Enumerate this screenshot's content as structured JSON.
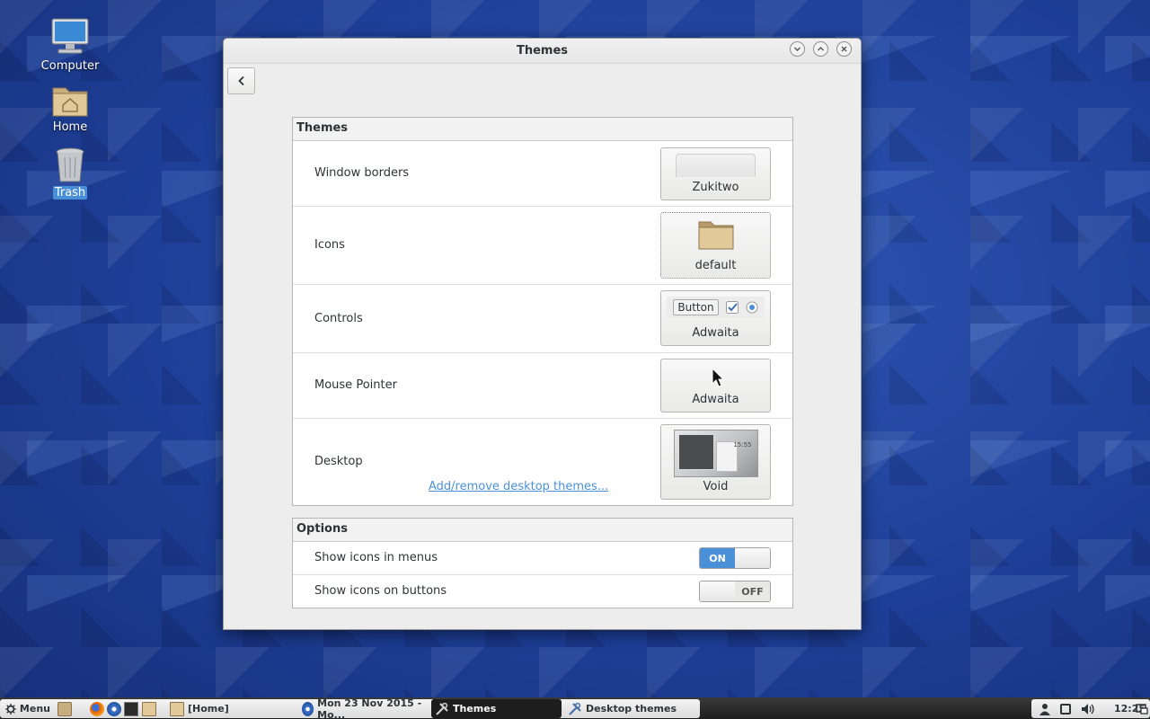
{
  "desktop": {
    "icons": [
      {
        "label": "Computer"
      },
      {
        "label": "Home"
      },
      {
        "label": "Trash"
      }
    ]
  },
  "window": {
    "title": "Themes",
    "themes_section": {
      "header": "Themes",
      "rows": [
        {
          "label": "Window borders",
          "value": "Zukitwo"
        },
        {
          "label": "Icons",
          "value": "default"
        },
        {
          "label": "Controls",
          "value": "Adwaita",
          "preview_button": "Button"
        },
        {
          "label": "Mouse Pointer",
          "value": "Adwaita"
        },
        {
          "label": "Desktop",
          "value": "Void",
          "link": "Add/remove desktop themes...",
          "preview_clock": "15:55"
        }
      ]
    },
    "options_section": {
      "header": "Options",
      "rows": [
        {
          "label": "Show icons in menus",
          "state": "ON",
          "enabled": true
        },
        {
          "label": "Show icons on buttons",
          "state": "OFF",
          "enabled": false
        }
      ]
    }
  },
  "taskbar": {
    "menu_label": "Menu",
    "windows": [
      {
        "label": "[Home]"
      },
      {
        "label": "Mon 23 Nov 2015 - Mo..."
      },
      {
        "label": "Themes",
        "active": true
      },
      {
        "label": "Desktop themes"
      }
    ],
    "clock": "12:25"
  },
  "colors": {
    "accent": "#4a90d9",
    "desktop_bg": "#1e3f98"
  }
}
